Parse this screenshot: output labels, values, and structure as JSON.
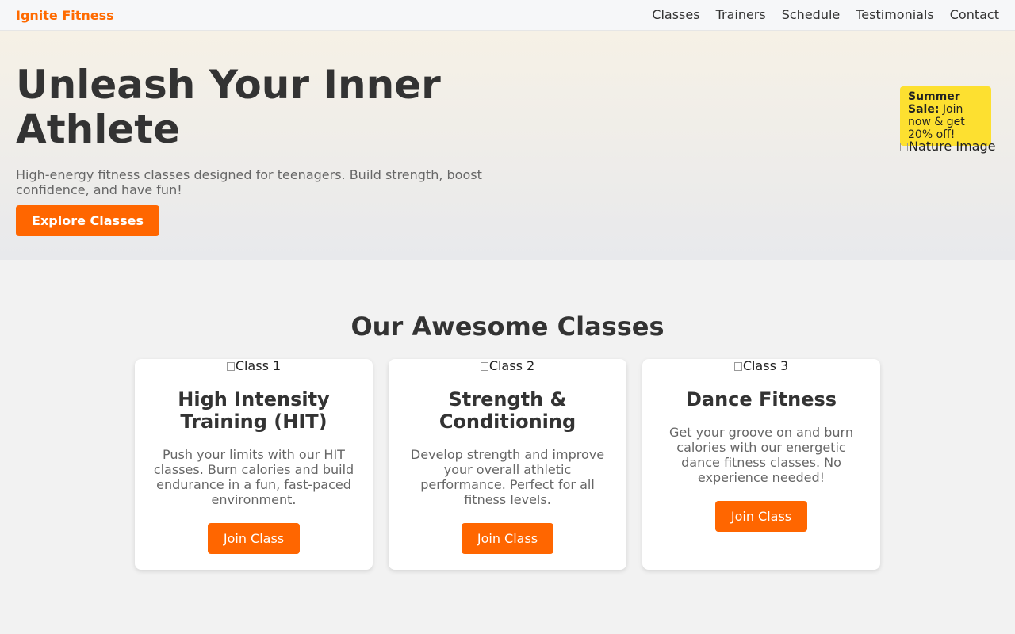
{
  "nav": {
    "brand": "Ignite Fitness",
    "links": [
      "Classes",
      "Trainers",
      "Schedule",
      "Testimonials",
      "Contact"
    ]
  },
  "hero": {
    "title": "Unleash Your Inner Athlete",
    "subtitle": "High-energy fitness classes designed for teenagers. Build strength, boost confidence, and have fun!",
    "cta_label": "Explore Classes",
    "sale_bold": "Summer Sale:",
    "sale_text": "Join now & get 20% off!",
    "image_alt": "Nature Image"
  },
  "classes": {
    "heading": "Our Awesome Classes",
    "items": [
      {
        "image_alt": "Class 1",
        "title": "High Intensity Training (HIT)",
        "description": "Push your limits with our HIT classes. Burn calories and build endurance in a fun, fast-paced environment.",
        "button_label": "Join Class"
      },
      {
        "image_alt": "Class 2",
        "title": "Strength & Conditioning",
        "description": "Develop strength and improve your overall athletic performance. Perfect for all fitness levels.",
        "button_label": "Join Class"
      },
      {
        "image_alt": "Class 3",
        "title": "Dance Fitness",
        "description": "Get your groove on and burn calories with our energetic dance fitness classes. No experience needed!",
        "button_label": "Join Class"
      }
    ]
  },
  "colors": {
    "accent": "#ff6600",
    "sale_badge": "#fde030",
    "page_background": "#f2f2f2"
  }
}
